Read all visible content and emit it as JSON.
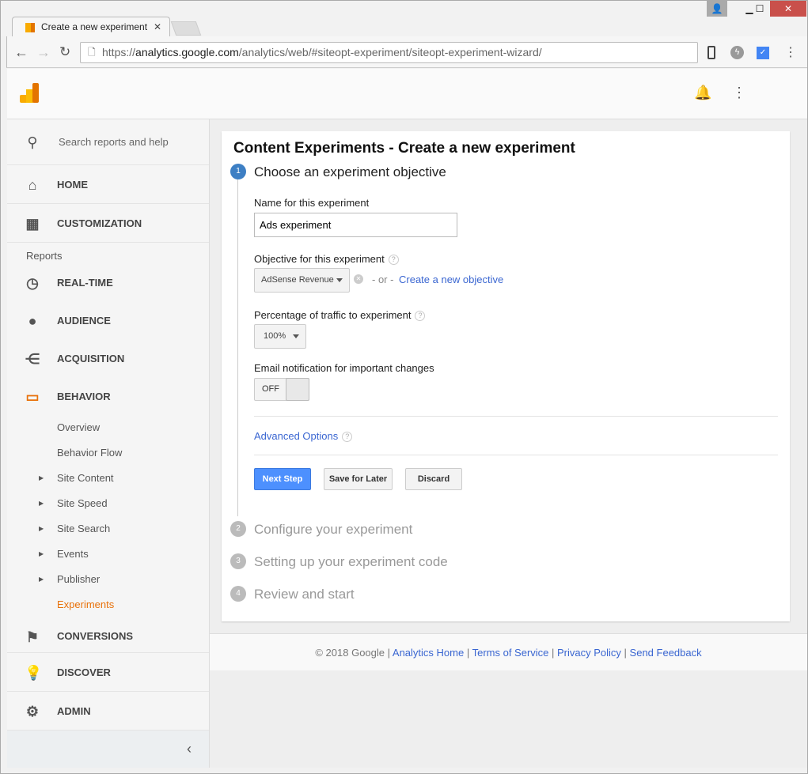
{
  "browser": {
    "tab_title": "Create a new experiment",
    "url_scheme": "https://",
    "url_host": "analytics.google.com",
    "url_path": "/analytics/web/#siteopt-experiment/siteopt-experiment-wizard/"
  },
  "sidebar": {
    "search_placeholder": "Search reports and help",
    "home": "HOME",
    "customization": "CUSTOMIZATION",
    "reports_label": "Reports",
    "items": [
      {
        "label": "REAL-TIME",
        "icon": "clock-icon"
      },
      {
        "label": "AUDIENCE",
        "icon": "person-icon"
      },
      {
        "label": "ACQUISITION",
        "icon": "acquisition-icon"
      },
      {
        "label": "BEHAVIOR",
        "icon": "behavior-icon"
      }
    ],
    "behavior_sub": [
      {
        "label": "Overview"
      },
      {
        "label": "Behavior Flow"
      },
      {
        "label": "Site Content",
        "expandable": true
      },
      {
        "label": "Site Speed",
        "expandable": true
      },
      {
        "label": "Site Search",
        "expandable": true
      },
      {
        "label": "Events",
        "expandable": true
      },
      {
        "label": "Publisher",
        "expandable": true
      },
      {
        "label": "Experiments",
        "active": true
      }
    ],
    "conversions": "CONVERSIONS",
    "discover": "DISCOVER",
    "admin": "ADMIN"
  },
  "main": {
    "title": "Content Experiments - Create a new experiment",
    "steps": [
      {
        "num": "1",
        "label": "Choose an experiment objective"
      },
      {
        "num": "2",
        "label": "Configure your experiment"
      },
      {
        "num": "3",
        "label": "Setting up your experiment code"
      },
      {
        "num": "4",
        "label": "Review and start"
      }
    ],
    "name_label": "Name for this experiment",
    "name_value": "Ads experiment",
    "objective_label": "Objective for this experiment",
    "objective_value": "AdSense Revenue",
    "or": "- or -",
    "create_objective": "Create a new objective",
    "traffic_label": "Percentage of traffic to experiment",
    "traffic_value": "100%",
    "email_label": "Email notification for important changes",
    "email_toggle": "OFF",
    "advanced": "Advanced Options",
    "next": "Next Step",
    "save": "Save for Later",
    "discard": "Discard"
  },
  "footer": {
    "copyright": "© 2018 Google",
    "links": [
      "Analytics Home",
      "Terms of Service",
      "Privacy Policy",
      "Send Feedback"
    ]
  },
  "colors": {
    "accent": "#4d90fe",
    "active": "#e8710a",
    "link": "#3a66d1"
  }
}
